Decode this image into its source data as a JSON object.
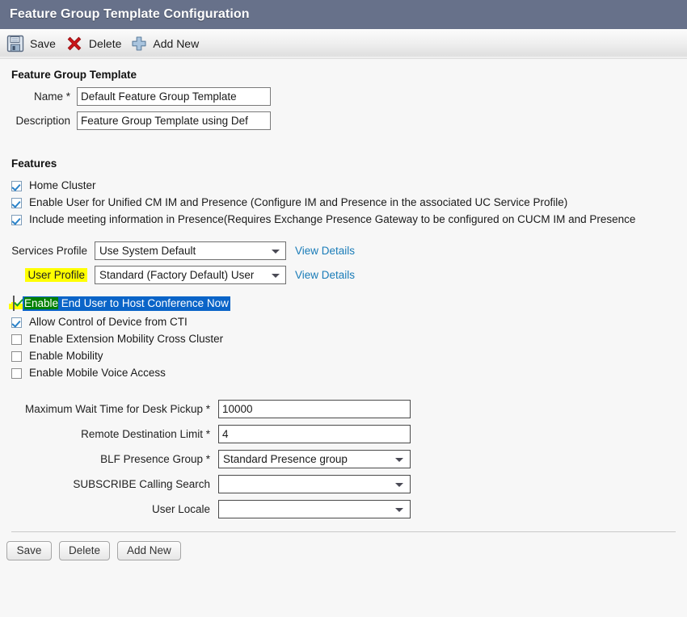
{
  "window": {
    "title": "Feature Group Template Configuration"
  },
  "toolbar": {
    "save_label": "Save",
    "delete_label": "Delete",
    "add_new_label": "Add New",
    "save_icon": "save-floppy-icon",
    "delete_icon": "red-x-icon",
    "add_new_icon": "blue-plus-icon"
  },
  "template_section": {
    "heading": "Feature Group Template",
    "name_label": "Name *",
    "name_value": "Default Feature Group Template",
    "name_placeholder": "",
    "description_label": "Description",
    "description_value": "Feature Group Template using Def",
    "description_placeholder": ""
  },
  "features_section": {
    "heading": "Features",
    "checkboxes": [
      {
        "label": "Home Cluster",
        "checked": true
      },
      {
        "label": "Enable User for Unified CM IM and Presence (Configure IM and Presence in the associated UC Service Profile)",
        "checked": true
      },
      {
        "label": "Include meeting information in Presence(Requires Exchange Presence Gateway to be configured on CUCM IM and Presence",
        "checked": true
      }
    ]
  },
  "profiles": {
    "services_profile_label": "Services Profile",
    "services_profile_value": "Use System Default",
    "services_profile_view_details": "View Details",
    "user_profile_label": "User Profile",
    "user_profile_value": "Standard (Factory Default) User",
    "user_profile_view_details": "View Details"
  },
  "conference_row": {
    "label_part_highlighted": "Enable",
    "label_part_rest": " End User to Host Conference Now",
    "full_label": "Enable End User to Host Conference Now",
    "checked": true
  },
  "feature_checkboxes": [
    {
      "label": "Allow Control of Device from CTI",
      "checked": true
    },
    {
      "label": "Enable Extension Mobility Cross Cluster",
      "checked": false
    },
    {
      "label": "Enable Mobility",
      "checked": false
    },
    {
      "label": "Enable Mobile Voice Access",
      "checked": false
    }
  ],
  "settings": {
    "max_wait_label": "Maximum Wait Time for Desk Pickup *",
    "max_wait_value": "10000",
    "remote_dest_label": "Remote Destination Limit *",
    "remote_dest_value": "4",
    "blf_label": "BLF Presence Group *",
    "blf_value": "Standard Presence group",
    "subscribe_label": "SUBSCRIBE Calling Search",
    "subscribe_value": "",
    "user_locale_label": "User Locale",
    "user_locale_value": ""
  },
  "footer": {
    "save_label": "Save",
    "delete_label": "Delete",
    "add_new_label": "Add New"
  },
  "colors": {
    "titlebar": "#67718a",
    "link": "#1a7cb8",
    "highlight_yellow": "#ffff00",
    "selection_blue": "#0a64c8",
    "selection_green": "#008000",
    "checkbox_blue": "#2b83c9",
    "checkbox_green": "#0f9d2f"
  }
}
